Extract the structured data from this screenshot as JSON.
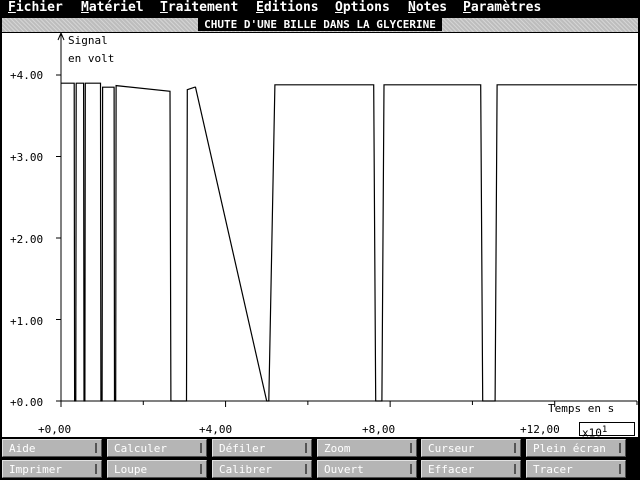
{
  "menu": [
    {
      "hot": "F",
      "rest": "ichier"
    },
    {
      "hot": "M",
      "rest": "atériel"
    },
    {
      "hot": "T",
      "rest": "raitement"
    },
    {
      "hot": "E",
      "rest": "ditions"
    },
    {
      "hot": "O",
      "rest": "ptions"
    },
    {
      "hot": "N",
      "rest": "otes"
    },
    {
      "hot": "P",
      "rest": "aramètres"
    }
  ],
  "window_title": "CHUTE D'UNE BILLE DANS LA GLYCERINE",
  "axes": {
    "ylabel_line1": "Signal",
    "ylabel_line2": "en volt",
    "xlabel": "Temps en s",
    "x_multiplier": "x10",
    "x_multiplier_exp": "1",
    "y_ticks": [
      "+4.00",
      "+3.00",
      "+2.00",
      "+1.00",
      "+0.00"
    ],
    "x_ticks": [
      "+0,00",
      "+4,00",
      "+8,00",
      "+12,00"
    ]
  },
  "chart_data": {
    "type": "line",
    "xlabel": "Temps en s",
    "ylabel": "Signal en volt",
    "x_scale_factor": 10,
    "xlim": [
      0,
      14
    ],
    "ylim": [
      0,
      4.2
    ],
    "grid": false,
    "series": [
      {
        "x": [
          0.0,
          0.32,
          0.33,
          0.36,
          0.37,
          0.55,
          0.56,
          0.58,
          0.59,
          0.96,
          0.97,
          1.0,
          1.01,
          1.29,
          1.3,
          1.33,
          1.34,
          2.65,
          2.67,
          3.05,
          3.07,
          3.25,
          3.27,
          5.0,
          5.05,
          5.2,
          5.25,
          7.6,
          7.65,
          7.8,
          7.85,
          10.2,
          10.25,
          10.55,
          10.6,
          14.0
        ],
        "y": [
          3.9,
          3.9,
          0,
          0,
          3.9,
          3.9,
          0,
          0,
          3.9,
          3.9,
          0,
          0,
          3.85,
          3.85,
          0,
          0,
          3.87,
          3.8,
          0,
          0,
          3.82,
          3.85,
          3.85,
          0,
          0,
          3.88,
          3.88,
          3.88,
          0,
          0,
          3.88,
          3.88,
          0,
          0,
          3.88,
          3.88
        ]
      }
    ],
    "baseline": 0
  },
  "buttons_row1": [
    "Aide",
    "Calculer",
    "Défiler",
    "Zoom",
    "Curseur",
    "Plein écran"
  ],
  "buttons_row2": [
    "Imprimer",
    "Loupe",
    "Calibrer",
    "Ouvert",
    "Effacer",
    "Tracer"
  ]
}
